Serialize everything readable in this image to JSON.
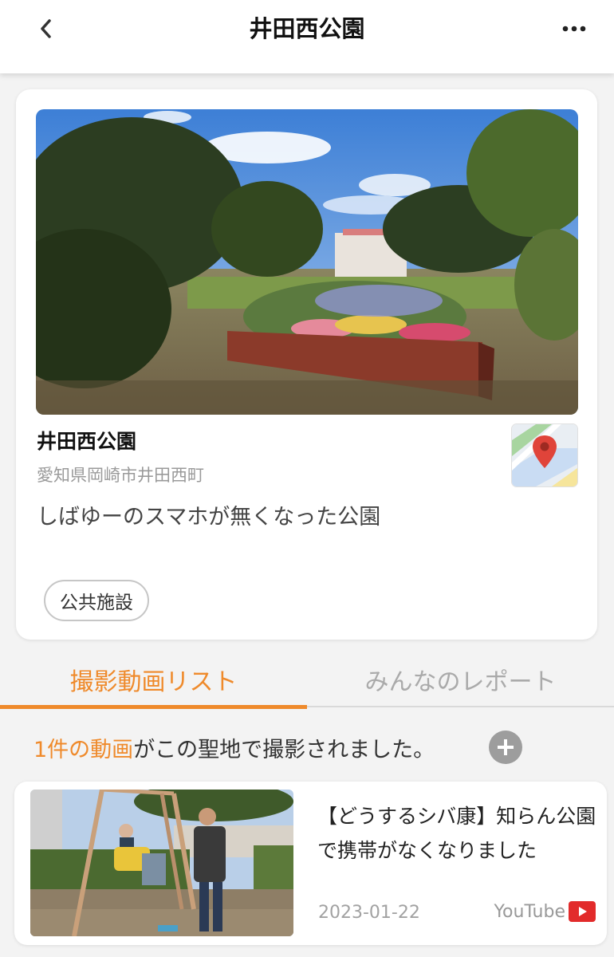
{
  "header": {
    "title": "井田西公園",
    "back_icon": "chevron-left-icon",
    "more_icon": "more-horizontal-icon"
  },
  "place": {
    "name": "井田西公園",
    "address": "愛知県岡崎市井田西町",
    "description": "しばゆーのスマホが無くなった公園",
    "tag": "公共施設",
    "map_icon": "map-pin-icon"
  },
  "tabs": [
    {
      "label": "撮影動画リスト",
      "active": true
    },
    {
      "label": "みんなのレポート",
      "active": false
    }
  ],
  "video_count": {
    "highlight": "1件の動画",
    "rest": "がこの聖地で撮影されました。",
    "add_icon": "plus-circle-icon"
  },
  "videos": [
    {
      "title": "【どうするシバ康】知らん公園で携帯がなくなりました",
      "date": "2023-01-22",
      "source": "YouTube",
      "source_icon": "youtube-play-icon"
    }
  ],
  "colors": {
    "accent": "#ef8a2b",
    "youtube": "#e22b2b",
    "background": "#f3f3f3"
  }
}
